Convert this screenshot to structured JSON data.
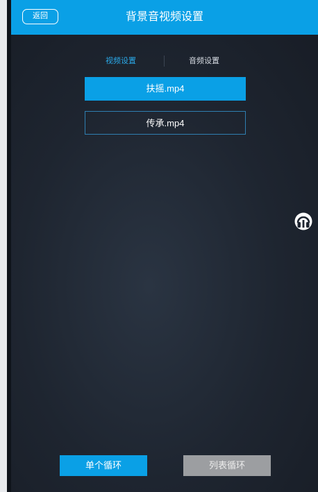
{
  "header": {
    "back_label": "返回",
    "title": "背景音视频设置"
  },
  "tabs": [
    {
      "label": "视频设置",
      "active": true
    },
    {
      "label": "音频设置",
      "active": false
    }
  ],
  "files": [
    {
      "label": "扶摇.mp4",
      "selected": true
    },
    {
      "label": "传承.mp4",
      "selected": false
    }
  ],
  "side_icon": "headphones-icon",
  "buttons": {
    "single_loop": "单个循环",
    "list_loop": "列表循环"
  },
  "colors": {
    "accent": "#0aa0e6",
    "background": "#1e2530",
    "disabled": "#9c9ea1"
  }
}
